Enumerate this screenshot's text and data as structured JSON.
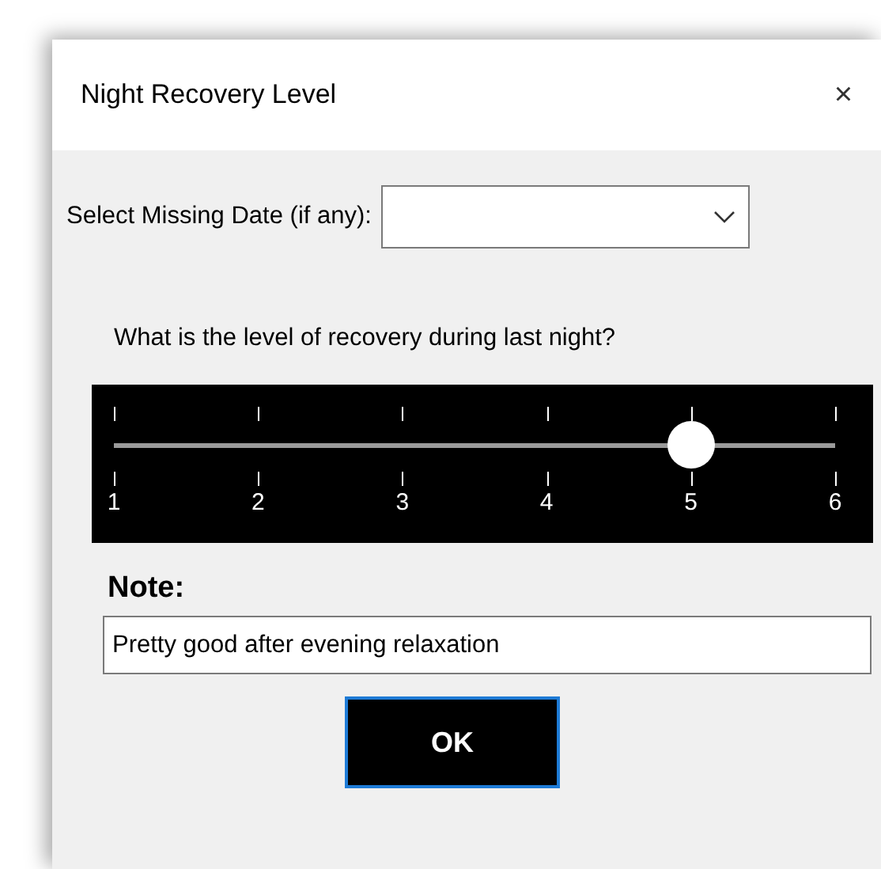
{
  "window": {
    "title": "Night Recovery Level",
    "close": "×"
  },
  "date_field": {
    "label": "Select Missing Date (if any):"
  },
  "question": "What is the level of recovery during last night?",
  "slider": {
    "level": 0.8,
    "labels": [
      "1",
      "2",
      "3",
      "4",
      "5",
      "6"
    ]
  },
  "note": {
    "label": "Note:",
    "value": "Pretty good after evening relaxation"
  },
  "buttons": [
    "OK"
  ]
}
